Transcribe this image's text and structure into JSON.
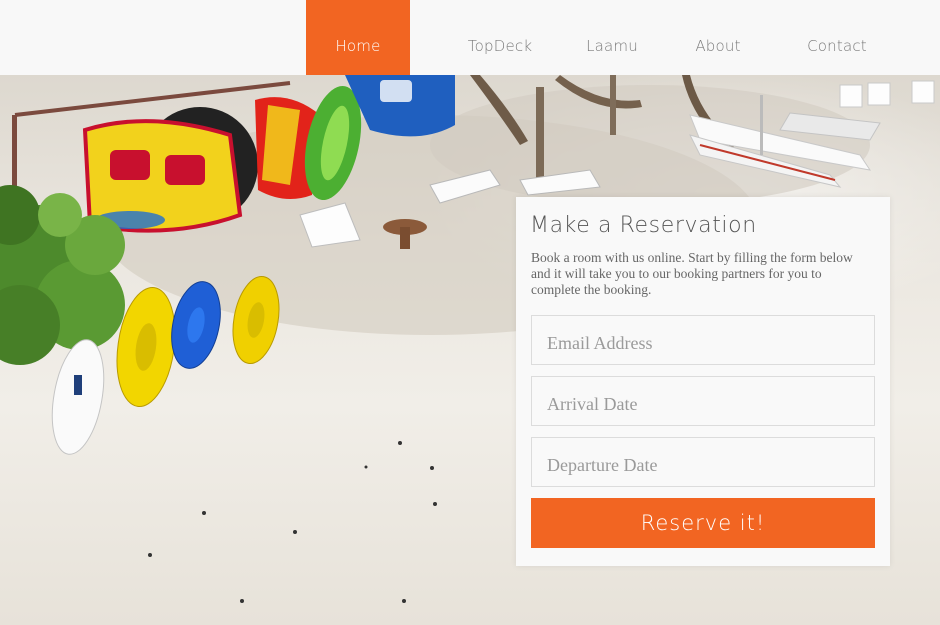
{
  "nav": {
    "items": [
      {
        "label": "Home",
        "active": true
      },
      {
        "label": "TopDeck",
        "active": false
      },
      {
        "label": "Laamu",
        "active": false
      },
      {
        "label": "About",
        "active": false
      },
      {
        "label": "Contact",
        "active": false
      }
    ]
  },
  "reservation": {
    "title": "Make a Reservation",
    "description": "Book a room with us online. Start by filling the form below and it will take you to our booking partners for you to complete the booking.",
    "email_placeholder": "Email Address",
    "arrival_placeholder": "Arrival Date",
    "departure_placeholder": "Departure Date",
    "submit_label": "Reserve it!"
  },
  "colors": {
    "accent": "#f26522",
    "nav_background": "#f8f8f8",
    "card_background": "#f9f9f9"
  }
}
